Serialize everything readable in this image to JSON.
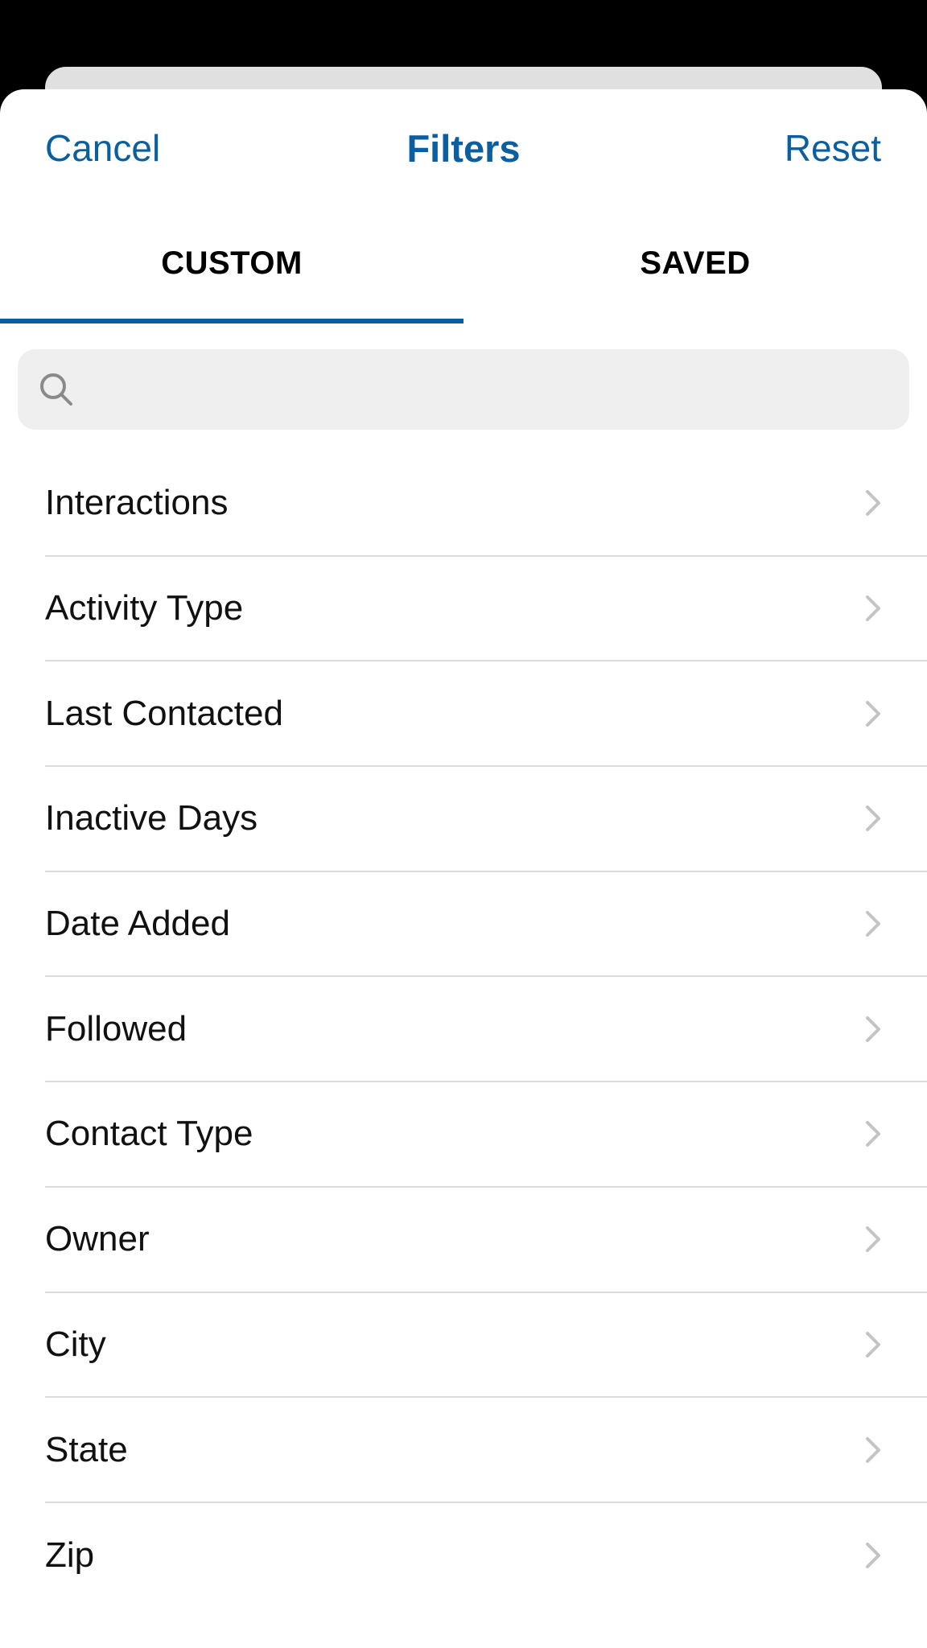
{
  "nav": {
    "cancel_label": "Cancel",
    "title": "Filters",
    "reset_label": "Reset"
  },
  "tabs": [
    {
      "label": "CUSTOM",
      "active": true
    },
    {
      "label": "SAVED",
      "active": false
    }
  ],
  "search": {
    "value": "",
    "placeholder": "",
    "icon": "search-icon"
  },
  "filters": [
    {
      "label": "Interactions",
      "icon": "chevron-right-icon"
    },
    {
      "label": "Activity Type",
      "icon": "chevron-right-icon"
    },
    {
      "label": "Last Contacted",
      "icon": "chevron-right-icon"
    },
    {
      "label": "Inactive Days",
      "icon": "chevron-right-icon"
    },
    {
      "label": "Date Added",
      "icon": "chevron-right-icon"
    },
    {
      "label": "Followed",
      "icon": "chevron-right-icon"
    },
    {
      "label": "Contact Type",
      "icon": "chevron-right-icon"
    },
    {
      "label": "Owner",
      "icon": "chevron-right-icon"
    },
    {
      "label": "City",
      "icon": "chevron-right-icon"
    },
    {
      "label": "State",
      "icon": "chevron-right-icon"
    },
    {
      "label": "Zip",
      "icon": "chevron-right-icon"
    }
  ],
  "colors": {
    "accent": "#0b5fa0",
    "search_bg": "#efefef",
    "divider": "#dcdcdc",
    "chevron": "#c4c4c4"
  }
}
